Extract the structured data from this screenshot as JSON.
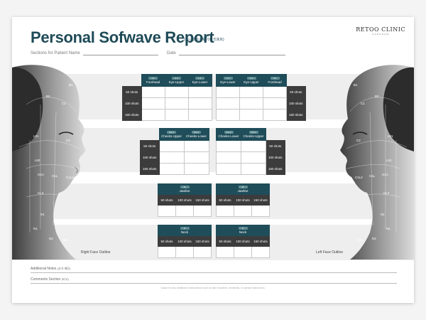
{
  "header": {
    "title": "Personal Sofwave Report",
    "subtitle": "(쏘니왈 소프웨이브 리포트)",
    "logo": "RETOO CLINIC",
    "logo_sub": "GANGNAM"
  },
  "patient": {
    "sections_label": "Sections for Patient Name",
    "date_label": "Date"
  },
  "grids": {
    "upper_right": {
      "columns": [
        {
          "code": "C1",
          "label": "Forehead"
        },
        {
          "code": "U-1",
          "label": "Eye-Upper"
        },
        {
          "code": "L-1",
          "label": "Eye-Lower"
        }
      ],
      "rows": [
        "50 shots",
        "100 shots",
        "150 shots"
      ]
    },
    "upper_left": {
      "columns": [
        {
          "code": "L-1",
          "label": "Eye-Lower"
        },
        {
          "code": "U-1",
          "label": "Eye-Upper"
        },
        {
          "code": "C1",
          "label": "Forehead"
        }
      ],
      "rows": [
        "50 shots",
        "100 shots",
        "150 shots"
      ]
    },
    "cheeks_right": {
      "columns": [
        {
          "code": "CH-1",
          "label": "Cheeks-Upper"
        },
        {
          "code": "CH-2",
          "label": "Cheeks-Lower"
        }
      ],
      "rows": [
        "50 shots",
        "100 shots",
        "150 shots"
      ]
    },
    "cheeks_left": {
      "columns": [
        {
          "code": "CH-2",
          "label": "Cheeks-Lower"
        },
        {
          "code": "CH-1",
          "label": "Cheeks-Upper"
        }
      ],
      "rows": [
        "50 shots",
        "100 shots",
        "150 shots"
      ]
    },
    "jawline_right": {
      "code": "J1",
      "label": "Jawline",
      "shots": [
        "50 shots",
        "100 shots",
        "150 shots"
      ]
    },
    "jawline_left": {
      "code": "J1",
      "label": "Jawline",
      "shots": [
        "50 shots",
        "100 shots",
        "150 shots"
      ]
    },
    "neck_right": {
      "code": "N",
      "label": "Neck",
      "shots": [
        "50 shots",
        "100 shots",
        "150 shots"
      ]
    },
    "neck_left": {
      "code": "N",
      "label": "Neck",
      "shots": [
        "50 shots",
        "100 shots",
        "150 shots"
      ]
    }
  },
  "outlines": {
    "right": "Right Face Outline",
    "left": "Left Face Outline"
  },
  "zones": [
    "B1",
    "B2",
    "C1",
    "C2",
    "L01",
    "L02",
    "G1A",
    "C1L",
    "C1L2",
    "CL3",
    "S4",
    "S5",
    "N1",
    "N2",
    "N3"
  ],
  "notes": {
    "additional_label": "Additional Notes",
    "additional_ko": "(추가 메모)",
    "comments_label": "Comments Section",
    "comments_ko": "(비고)",
    "footer": "Space for any additional observations such as skin reactions, sensitivity, or special instructions."
  },
  "colors": {
    "header_teal": "#1f4d59",
    "row_dark": "#3c3c3c",
    "title": "#1e4a57"
  }
}
